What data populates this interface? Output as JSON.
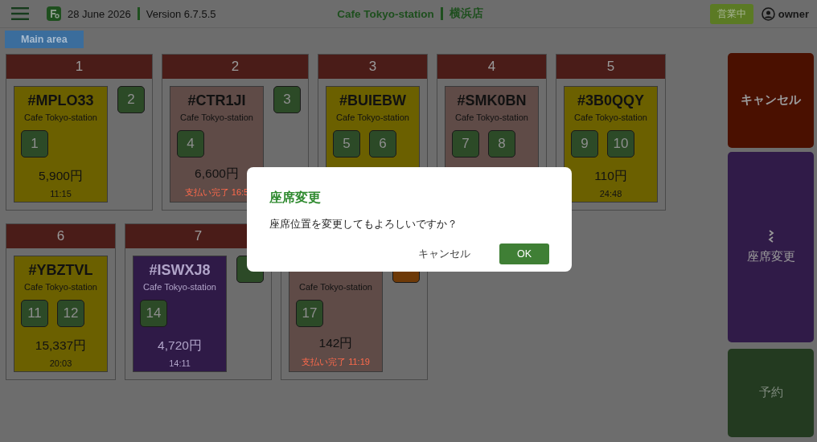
{
  "header": {
    "date": "28 June 2026",
    "version": "Version 6.7.5.5",
    "store": "Cafe Tokyo-station",
    "branch": "横浜店",
    "status": "営業中",
    "user": "owner"
  },
  "areas": [
    {
      "label": "Main area",
      "selected": true
    }
  ],
  "tables": [
    {
      "number": "1",
      "order": {
        "id": "#MPLO33",
        "store": "Cafe Tokyo-station",
        "color": "#6b6000",
        "seats": [
          {
            "label": "1",
            "color": "#2c4a27"
          }
        ],
        "total": "5,900円",
        "footer": {
          "kind": "time",
          "text": "11:15"
        }
      },
      "free_seats": [
        {
          "label": "2",
          "color": "#2c4a27"
        }
      ]
    },
    {
      "number": "2",
      "order": {
        "id": "#CTR1JI",
        "store": "Cafe Tokyo-station",
        "color": "#5f4b47",
        "seats": [
          {
            "label": "4",
            "color": "#2c4a27"
          }
        ],
        "total": "6,600円",
        "footer": {
          "kind": "paid",
          "text": "支払い完了 16:5"
        }
      },
      "free_seats": [
        {
          "label": "3",
          "color": "#2c4a27"
        }
      ]
    },
    {
      "number": "3",
      "order": {
        "id": "#BUIEBW",
        "store": "Cafe Tokyo-station",
        "color": "#6b6000",
        "seats": [
          {
            "label": "5",
            "color": "#2c4a27"
          },
          {
            "label": "6",
            "color": "#2c4a27"
          }
        ]
      }
    },
    {
      "number": "4",
      "order": {
        "id": "#SMK0BN",
        "store": "Cafe Tokyo-station",
        "color": "#5f4b47",
        "seats": [
          {
            "label": "7",
            "color": "#2c4a27"
          },
          {
            "label": "8",
            "color": "#2c4a27"
          }
        ]
      }
    },
    {
      "number": "5",
      "order": {
        "id": "#3B0QQY",
        "store": "Cafe Tokyo-station",
        "color": "#6b6000",
        "seats": [
          {
            "label": "9",
            "color": "#2c4a27"
          },
          {
            "label": "10",
            "color": "#2c4a27"
          }
        ],
        "total": "110円",
        "footer": {
          "kind": "time",
          "text": "24:48"
        }
      }
    },
    {
      "number": "6",
      "order": {
        "id": "#YBZTVL",
        "store": "Cafe Tokyo-station",
        "color": "#6b6000",
        "seats": [
          {
            "label": "11",
            "color": "#2c4a27"
          },
          {
            "label": "12",
            "color": "#2c4a27"
          }
        ],
        "total": "15,337円",
        "footer": {
          "kind": "time",
          "text": "20:03"
        }
      }
    },
    {
      "number": "7",
      "order": {
        "id": "#ISWXJ8",
        "store": "Cafe Tokyo-station",
        "color": "#2f1a47",
        "seats": [
          {
            "label": "14",
            "color": "#2c4a27"
          }
        ],
        "total": "4,720円",
        "footer": {
          "kind": "time",
          "text": "14:11"
        }
      },
      "free_seats": [
        {
          "color": "#2c4a27"
        }
      ]
    },
    {
      "order": {
        "store": "Cafe Tokyo-station",
        "color": "#5f4b47",
        "seats": [
          {
            "label": "17",
            "color": "#2c4a27"
          }
        ],
        "total": "142円",
        "footer": {
          "kind": "paid",
          "text": "支払い完了 11:19"
        }
      },
      "free_seats": [
        {
          "color": "#6e3a08"
        }
      ]
    }
  ],
  "actions": [
    {
      "label": "キャンセル",
      "kind": "cancel"
    },
    {
      "label": "座席変更",
      "kind": "move"
    },
    {
      "label": "予約",
      "kind": "reserve"
    }
  ],
  "dialog": {
    "title": "座席変更",
    "message": "座席位置を変更してもよろしいですか？",
    "buttons": [
      {
        "label": "キャンセル",
        "kind": "text"
      },
      {
        "label": "OK",
        "kind": "primary"
      }
    ]
  }
}
